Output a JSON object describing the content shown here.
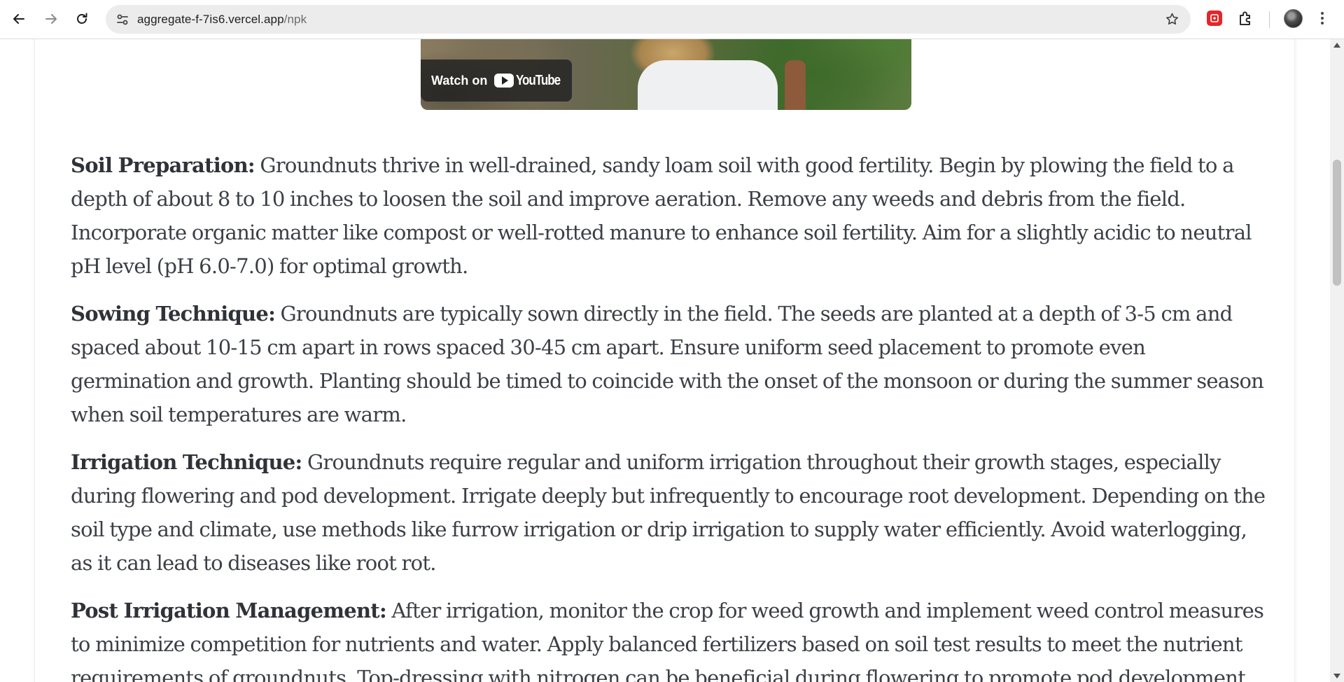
{
  "browser": {
    "url_host": "aggregate-f-7is6.vercel.app",
    "url_path": "/npk",
    "icons": {
      "back": "arrow-left-icon",
      "forward": "arrow-right-icon",
      "reload": "reload-icon",
      "site_info": "tune-icon",
      "bookmark": "star-icon",
      "extension": "extension-red-icon",
      "extensions_menu": "puzzle-icon",
      "profile": "avatar",
      "menu": "kebab-menu-icon"
    }
  },
  "video": {
    "watch_label": "Watch on",
    "brand": "YouTube"
  },
  "article": {
    "sections": [
      {
        "heading": "Soil Preparation:",
        "body": "Groundnuts thrive in well-drained, sandy loam soil with good fertility. Begin by plowing the field to a depth of about 8 to 10 inches to loosen the soil and improve aeration. Remove any weeds and debris from the field. Incorporate organic matter like compost or well-rotted manure to enhance soil fertility. Aim for a slightly acidic to neutral pH level (pH 6.0-7.0) for optimal growth."
      },
      {
        "heading": "Sowing Technique:",
        "body": "Groundnuts are typically sown directly in the field. The seeds are planted at a depth of 3-5 cm and spaced about 10-15 cm apart in rows spaced 30-45 cm apart. Ensure uniform seed placement to promote even germination and growth. Planting should be timed to coincide with the onset of the monsoon or during the summer season when soil temperatures are warm."
      },
      {
        "heading": "Irrigation Technique:",
        "body": "Groundnuts require regular and uniform irrigation throughout their growth stages, especially during flowering and pod development. Irrigate deeply but infrequently to encourage root development. Depending on the soil type and climate, use methods like furrow irrigation or drip irrigation to supply water efficiently. Avoid waterlogging, as it can lead to diseases like root rot."
      },
      {
        "heading": "Post Irrigation Management:",
        "body": "After irrigation, monitor the crop for weed growth and implement weed control measures to minimize competition for nutrients and water. Apply balanced fertilizers based on soil test results to meet the nutrient requirements of groundnuts. Top-dressing with nitrogen can be beneficial during flowering to promote pod development."
      }
    ]
  }
}
